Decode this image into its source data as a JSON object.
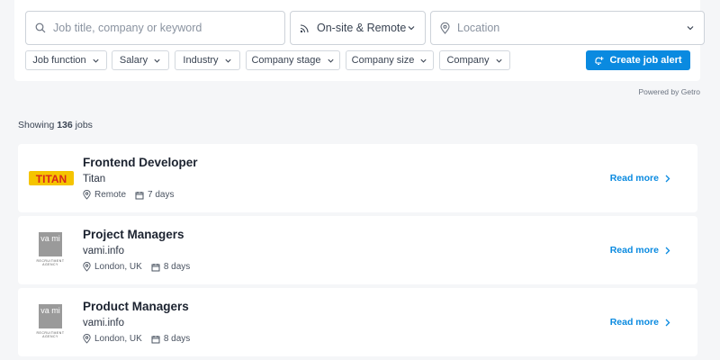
{
  "search": {
    "keyword_placeholder": "Job title, company or keyword",
    "work_type": "On-site & Remote",
    "location_placeholder": "Location"
  },
  "filters": [
    {
      "label": "Job function"
    },
    {
      "label": "Salary"
    },
    {
      "label": "Industry"
    },
    {
      "label": "Company stage"
    },
    {
      "label": "Company size"
    },
    {
      "label": "Company"
    }
  ],
  "create_alert_label": "Create job alert",
  "powered_by": "Powered by Getro",
  "results": {
    "prefix": "Showing ",
    "count": "136",
    "suffix": " jobs"
  },
  "jobs": [
    {
      "title": "Frontend Developer",
      "company": "Titan",
      "logo_text": "TITAN",
      "location": "Remote",
      "posted": "7 days",
      "read_more": "Read more"
    },
    {
      "title": "Project Managers",
      "company": "vami.info",
      "logo_text": "va mi",
      "logo_caption": "RECRUITMENT AGENCY",
      "location": "London, UK",
      "posted": "8 days",
      "read_more": "Read more"
    },
    {
      "title": "Product Managers",
      "company": "vami.info",
      "logo_text": "va mi",
      "logo_caption": "RECRUITMENT AGENCY",
      "location": "London, UK",
      "posted": "8 days",
      "read_more": "Read more"
    }
  ],
  "colors": {
    "accent": "#0a8ae0",
    "background": "#f5f6f8",
    "titan_red": "#d8261c",
    "titan_yellow": "#f5c400",
    "vami_gray": "#9a9a9a"
  }
}
